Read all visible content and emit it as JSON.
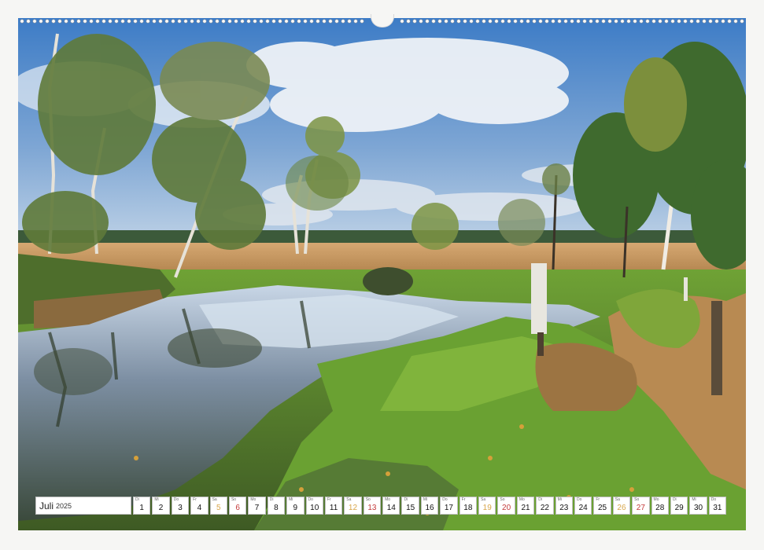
{
  "calendar": {
    "month": "Juli",
    "year": "2025",
    "days": [
      {
        "wd": "Di",
        "d": "1",
        "type": "week"
      },
      {
        "wd": "Mi",
        "d": "2",
        "type": "week"
      },
      {
        "wd": "Do",
        "d": "3",
        "type": "week"
      },
      {
        "wd": "Fr",
        "d": "4",
        "type": "week"
      },
      {
        "wd": "Sa",
        "d": "5",
        "type": "sat"
      },
      {
        "wd": "So",
        "d": "6",
        "type": "sun"
      },
      {
        "wd": "Mo",
        "d": "7",
        "type": "week"
      },
      {
        "wd": "Di",
        "d": "8",
        "type": "week"
      },
      {
        "wd": "Mi",
        "d": "9",
        "type": "week"
      },
      {
        "wd": "Do",
        "d": "10",
        "type": "week"
      },
      {
        "wd": "Fr",
        "d": "11",
        "type": "week"
      },
      {
        "wd": "Sa",
        "d": "12",
        "type": "sat"
      },
      {
        "wd": "So",
        "d": "13",
        "type": "sun"
      },
      {
        "wd": "Mo",
        "d": "14",
        "type": "week"
      },
      {
        "wd": "Di",
        "d": "15",
        "type": "week"
      },
      {
        "wd": "Mi",
        "d": "16",
        "type": "week"
      },
      {
        "wd": "Do",
        "d": "17",
        "type": "week"
      },
      {
        "wd": "Fr",
        "d": "18",
        "type": "week"
      },
      {
        "wd": "Sa",
        "d": "19",
        "type": "sat"
      },
      {
        "wd": "So",
        "d": "20",
        "type": "sun"
      },
      {
        "wd": "Mo",
        "d": "21",
        "type": "week"
      },
      {
        "wd": "Di",
        "d": "22",
        "type": "week"
      },
      {
        "wd": "Mi",
        "d": "23",
        "type": "week"
      },
      {
        "wd": "Do",
        "d": "24",
        "type": "week"
      },
      {
        "wd": "Fr",
        "d": "25",
        "type": "week"
      },
      {
        "wd": "Sa",
        "d": "26",
        "type": "sat"
      },
      {
        "wd": "So",
        "d": "27",
        "type": "sun"
      },
      {
        "wd": "Mo",
        "d": "28",
        "type": "week"
      },
      {
        "wd": "Di",
        "d": "29",
        "type": "week"
      },
      {
        "wd": "Mi",
        "d": "30",
        "type": "week"
      },
      {
        "wd": "Do",
        "d": "31",
        "type": "week"
      }
    ]
  },
  "colors": {
    "sky_top": "#3f7fc8",
    "sky_bottom": "#b9d0e6",
    "grass": "#5f9a2e",
    "reed": "#c99a5e",
    "water": "#5a6f86",
    "weekend_sat": "#d8a64a",
    "weekend_sun": "#c43a3a"
  }
}
